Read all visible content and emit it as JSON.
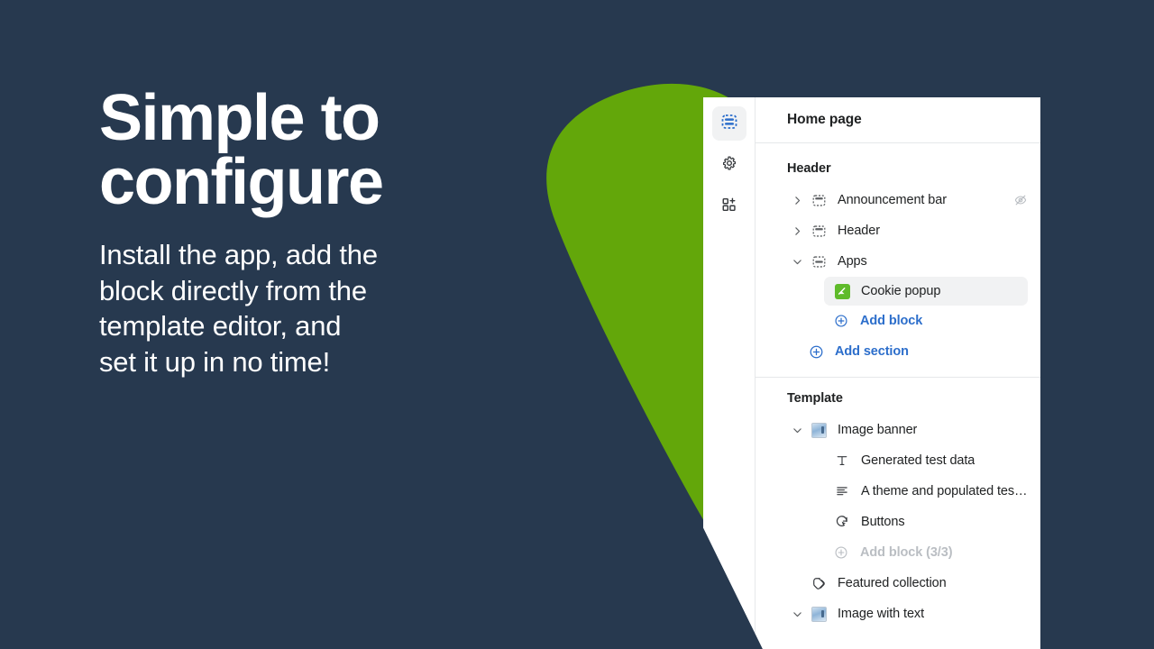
{
  "theme": {
    "background": "#27394f",
    "accent_green": "#63a70a",
    "panel_bg": "#ffffff",
    "link_blue": "#2c6ecb",
    "text_dark": "#202223",
    "text_muted": "#babec3"
  },
  "marketing": {
    "headline": "Simple to\nconfigure",
    "subcopy": "Install the app, add the\nblock directly from the\ntemplate editor, and\nset it up in no time!"
  },
  "editor": {
    "rail": [
      {
        "name": "sections-icon",
        "title": "Sections",
        "active": true
      },
      {
        "name": "gear-icon",
        "title": "Settings",
        "active": false
      },
      {
        "name": "app-blocks-icon",
        "title": "App blocks",
        "active": false
      }
    ],
    "header": {
      "title": "Home page"
    },
    "groups": [
      {
        "label": "Header",
        "rows": [
          {
            "label": "Announcement bar",
            "icon": "section-top-bar-icon",
            "caret": "right",
            "level": "section",
            "hidden_badge": true
          },
          {
            "label": "Header",
            "icon": "section-top-bar-icon",
            "caret": "right",
            "level": "section",
            "hidden_badge": false
          },
          {
            "label": "Apps",
            "icon": "section-center-bar-icon",
            "caret": "down",
            "level": "section",
            "hidden_badge": false
          },
          {
            "label": "Cookie popup",
            "icon": "app-thumb-icon",
            "caret": "none",
            "level": "block",
            "selected": true
          }
        ],
        "actions": [
          {
            "label": "Add block",
            "style": "blue",
            "indent": "block"
          },
          {
            "label": "Add section",
            "style": "blue",
            "indent": "section"
          }
        ]
      },
      {
        "label": "Template",
        "rows": [
          {
            "label": "Image banner",
            "icon": "image-thumb-icon",
            "caret": "down",
            "level": "section",
            "hidden_badge": false
          },
          {
            "label": "Generated test data",
            "icon": "text-block-icon",
            "caret": "none",
            "level": "block"
          },
          {
            "label": "A theme and populated test…",
            "icon": "paragraph-icon",
            "caret": "none",
            "level": "block"
          },
          {
            "label": "Buttons",
            "icon": "button-pointer-icon",
            "caret": "none",
            "level": "block"
          }
        ],
        "actions": [
          {
            "label": "Add block (3/3)",
            "style": "disabled",
            "indent": "block"
          }
        ],
        "rows_after": [
          {
            "label": "Featured collection",
            "icon": "collection-tag-icon",
            "caret": "none",
            "level": "section"
          },
          {
            "label": "Image with text",
            "icon": "image-thumb-icon",
            "caret": "down",
            "level": "section"
          }
        ]
      }
    ]
  }
}
